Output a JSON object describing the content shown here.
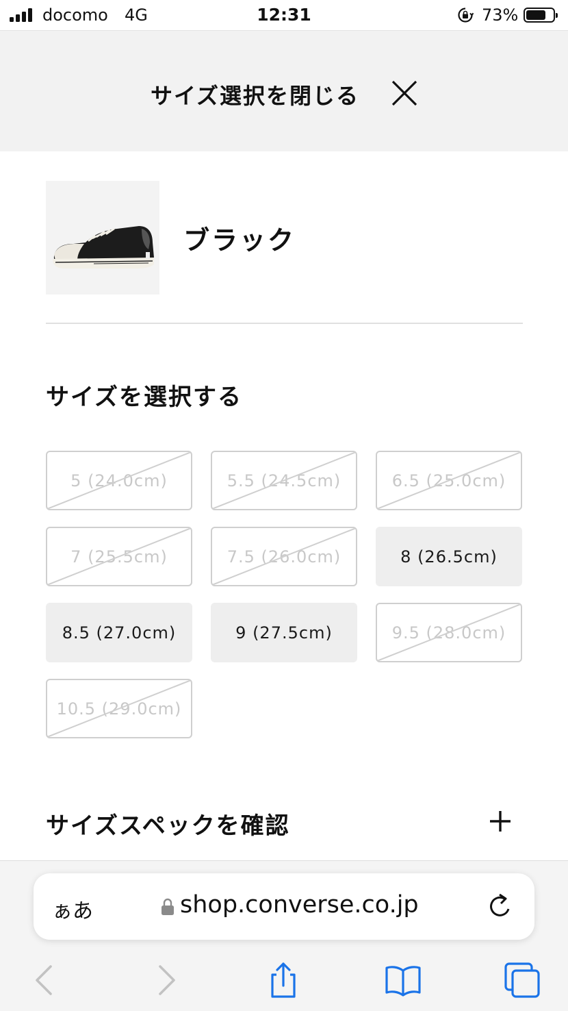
{
  "status_bar": {
    "carrier": "docomo",
    "network": "4G",
    "time": "12:31",
    "battery_percent_text": "73%",
    "battery_level": 0.73
  },
  "close_bar": {
    "label": "サイズ選択を閉じる",
    "icon": "close-icon"
  },
  "product": {
    "color_name": "ブラック",
    "image": "sneaker-thumbnail"
  },
  "size_section": {
    "heading": "サイズを選択する",
    "sizes": [
      {
        "label": "5 (24.0cm)",
        "available": false
      },
      {
        "label": "5.5 (24.5cm)",
        "available": false
      },
      {
        "label": "6.5 (25.0cm)",
        "available": false
      },
      {
        "label": "7 (25.5cm)",
        "available": false
      },
      {
        "label": "7.5 (26.0cm)",
        "available": false
      },
      {
        "label": "8 (26.5cm)",
        "available": true
      },
      {
        "label": "8.5 (27.0cm)",
        "available": true
      },
      {
        "label": "9 (27.5cm)",
        "available": true
      },
      {
        "label": "9.5 (28.0cm)",
        "available": false
      },
      {
        "label": "10.5 (29.0cm)",
        "available": false
      }
    ]
  },
  "size_spec": {
    "label": "サイズスペックを確認",
    "icon": "plus-icon"
  },
  "browser": {
    "aa_label": "ぁあ",
    "url": "shop.converse.co.jp",
    "accent_color": "#1a73e8",
    "toolbar_icons": [
      "back-icon",
      "forward-icon",
      "share-icon",
      "bookmarks-icon",
      "tabs-icon"
    ]
  }
}
